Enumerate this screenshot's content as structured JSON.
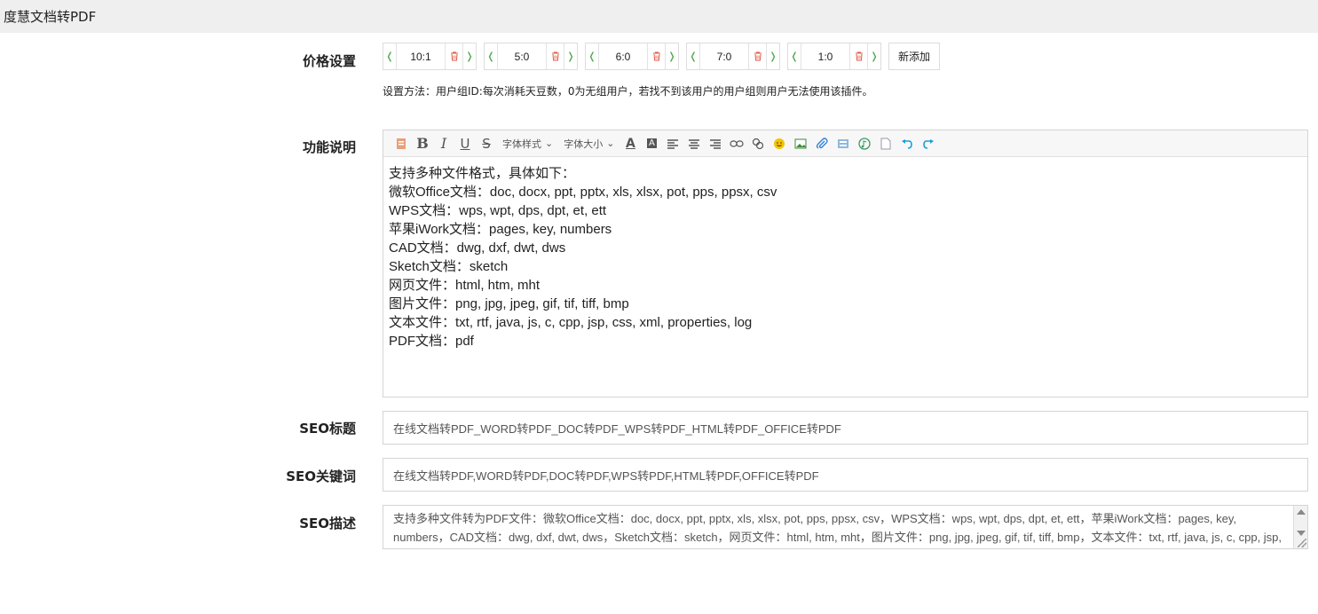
{
  "window": {
    "title": "度慧文档转PDF"
  },
  "price": {
    "label": "价格设置",
    "items": [
      {
        "value": "10:1"
      },
      {
        "value": "5:0"
      },
      {
        "value": "6:0"
      },
      {
        "value": "7:0"
      },
      {
        "value": "1:0"
      }
    ],
    "add_label": "新添加",
    "hint": "设置方法：用户组ID:每次消耗天豆数，0为无组用户，若找不到该用户的用户组则用户无法使用该插件。"
  },
  "feature": {
    "label": "功能说明",
    "toolbar": {
      "font_style": "字体样式",
      "font_size": "字体大小"
    },
    "lines": [
      "支持多种文件格式，具体如下：",
      "微软Office文档：doc, docx, ppt, pptx, xls, xlsx, pot, pps, ppsx, csv",
      "WPS文档：wps, wpt, dps, dpt, et, ett",
      "苹果iWork文档：pages, key, numbers",
      "CAD文档：dwg, dxf, dwt, dws",
      "Sketch文档：sketch",
      "网页文件：html, htm, mht",
      "图片文件：png, jpg, jpeg, gif, tif, tiff, bmp",
      "文本文件：txt, rtf, java, js, c, cpp, jsp, css, xml, properties, log",
      "PDF文档：pdf"
    ]
  },
  "seo_title": {
    "label": "SEO标题",
    "value": "在线文档转PDF_WORD转PDF_DOC转PDF_WPS转PDF_HTML转PDF_OFFICE转PDF"
  },
  "seo_keywords": {
    "label": "SEO关键词",
    "value": "在线文档转PDF,WORD转PDF,DOC转PDF,WPS转PDF,HTML转PDF,OFFICE转PDF"
  },
  "seo_desc": {
    "label": "SEO描述",
    "value": "支持多种文件转为PDF文件：微软Office文档：doc, docx, ppt, pptx, xls, xlsx, pot, pps, ppsx, csv，WPS文档：wps, wpt, dps, dpt, et, ett，苹果iWork文档：pages, key, numbers，CAD文档：dwg, dxf, dwt, dws，Sketch文档：sketch，网页文件：html, htm, mht，图片文件：png, jpg, jpeg, gif, tif, tiff, bmp，文本文件：txt, rtf, java, js, c, cpp, jsp, css, xml, properties, log，PDF文档：pdf"
  },
  "colors": {
    "arrow": "#4aa84a",
    "delete": "#e05a45",
    "topbar": "#efefef"
  }
}
